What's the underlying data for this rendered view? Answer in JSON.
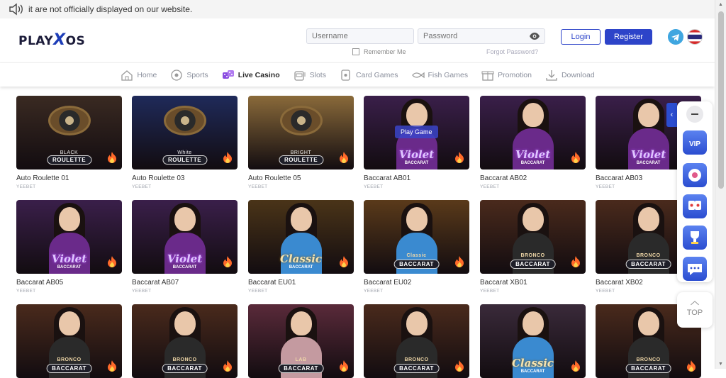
{
  "marquee": {
    "text": "it are not officially displayed on our website.",
    "icon": "speaker-icon"
  },
  "header": {
    "logo": {
      "pre": "PLAY",
      "x": "X",
      "post": "OS"
    },
    "username_placeholder": "Username",
    "password_placeholder": "Password",
    "remember_label": "Remember Me",
    "forgot_label": "Forgot Password?",
    "login_label": "Login",
    "register_label": "Register"
  },
  "nav": [
    {
      "label": "Home",
      "icon": "home-icon",
      "active": false
    },
    {
      "label": "Sports",
      "icon": "ball-icon",
      "active": false
    },
    {
      "label": "Live Casino",
      "icon": "dice-icon",
      "active": true
    },
    {
      "label": "Slots",
      "icon": "slot-machine-icon",
      "active": false
    },
    {
      "label": "Card Games",
      "icon": "card-icon",
      "active": false
    },
    {
      "label": "Fish Games",
      "icon": "fish-icon",
      "active": false
    },
    {
      "label": "Promotion",
      "icon": "gift-icon",
      "active": false
    },
    {
      "label": "Download",
      "icon": "download-icon",
      "active": false
    }
  ],
  "play_game_label": "Play Game",
  "games": [
    {
      "title": "Auto Roulette 01",
      "provider": "YEEBET",
      "kind": "roulette",
      "brand": "BLACK",
      "pill": "ROULETTE",
      "bg": "#3a2a22"
    },
    {
      "title": "Auto Roulette 03",
      "provider": "YEEBET",
      "kind": "roulette",
      "brand": "White",
      "pill": "ROULETTE",
      "bg": "#1f2a5a"
    },
    {
      "title": "Auto Roulette 05",
      "provider": "YEEBET",
      "kind": "roulette",
      "brand": "BRIGHT",
      "pill": "ROULETTE",
      "bg": "#8a6a3a"
    },
    {
      "title": "Baccarat AB01",
      "provider": "YEEBET",
      "kind": "violet",
      "brand": "Violet",
      "pill": "BACCARAT",
      "bg": "#3a1f4a",
      "hover": true
    },
    {
      "title": "Baccarat AB02",
      "provider": "YEEBET",
      "kind": "violet",
      "brand": "Violet",
      "pill": "BACCARAT",
      "bg": "#3a1f4a"
    },
    {
      "title": "Baccarat AB03",
      "provider": "YEEBET",
      "kind": "violet",
      "brand": "Violet",
      "pill": "BACCARAT",
      "bg": "#3a1f4a"
    },
    {
      "title": "Baccarat AB05",
      "provider": "YEEBET",
      "kind": "violet",
      "brand": "Violet",
      "pill": "BACCARAT",
      "bg": "#3a1f4a"
    },
    {
      "title": "Baccarat AB07",
      "provider": "YEEBET",
      "kind": "violet",
      "brand": "Violet",
      "pill": "BACCARAT",
      "bg": "#3a1f4a"
    },
    {
      "title": "Baccarat EU01",
      "provider": "YEEBET",
      "kind": "classic",
      "brand": "Classic",
      "pill": "BACCARAT",
      "bg": "#4a3418"
    },
    {
      "title": "Baccarat EU02",
      "provider": "YEEBET",
      "kind": "classic2",
      "brand": "Classic",
      "pill": "BACCARAT",
      "bg": "#5a3a1a"
    },
    {
      "title": "Baccarat XB01",
      "provider": "YEEBET",
      "kind": "bronco",
      "brand": "BRONCO",
      "pill": "BACCARAT",
      "bg": "#4a2a1c"
    },
    {
      "title": "Baccarat XB02",
      "provider": "YEEBET",
      "kind": "bronco",
      "brand": "BRONCO",
      "pill": "BACCARAT",
      "bg": "#4a2a1c"
    },
    {
      "title": "",
      "provider": "",
      "kind": "bronco",
      "brand": "BRONCO",
      "pill": "BACCARAT",
      "bg": "#4a2a1c"
    },
    {
      "title": "",
      "provider": "",
      "kind": "bronco",
      "brand": "BRONCO",
      "pill": "BACCARAT",
      "bg": "#4a2a1c"
    },
    {
      "title": "",
      "provider": "",
      "kind": "lab",
      "brand": "LAB",
      "pill": "BACCARAT",
      "bg": "#5a2a3a"
    },
    {
      "title": "",
      "provider": "",
      "kind": "bronco",
      "brand": "BRONCO",
      "pill": "BACCARAT",
      "bg": "#4a2a1c"
    },
    {
      "title": "",
      "provider": "",
      "kind": "classic",
      "brand": "Classic",
      "pill": "BACCARAT",
      "bg": "#3a2a3a"
    },
    {
      "title": "",
      "provider": "",
      "kind": "bronco",
      "brand": "BRONCO",
      "pill": "BACCARAT",
      "bg": "#4a2a1c"
    }
  ],
  "sidebar": {
    "items": [
      {
        "icon": "vip-icon",
        "label": "VIP"
      },
      {
        "icon": "wheel-icon"
      },
      {
        "icon": "cards-icon"
      },
      {
        "icon": "trophy-icon"
      },
      {
        "icon": "chat-icon"
      }
    ]
  },
  "top_label": "TOP",
  "colors": {
    "accent": "#2d44c9",
    "flame": "#ff6a2a"
  }
}
